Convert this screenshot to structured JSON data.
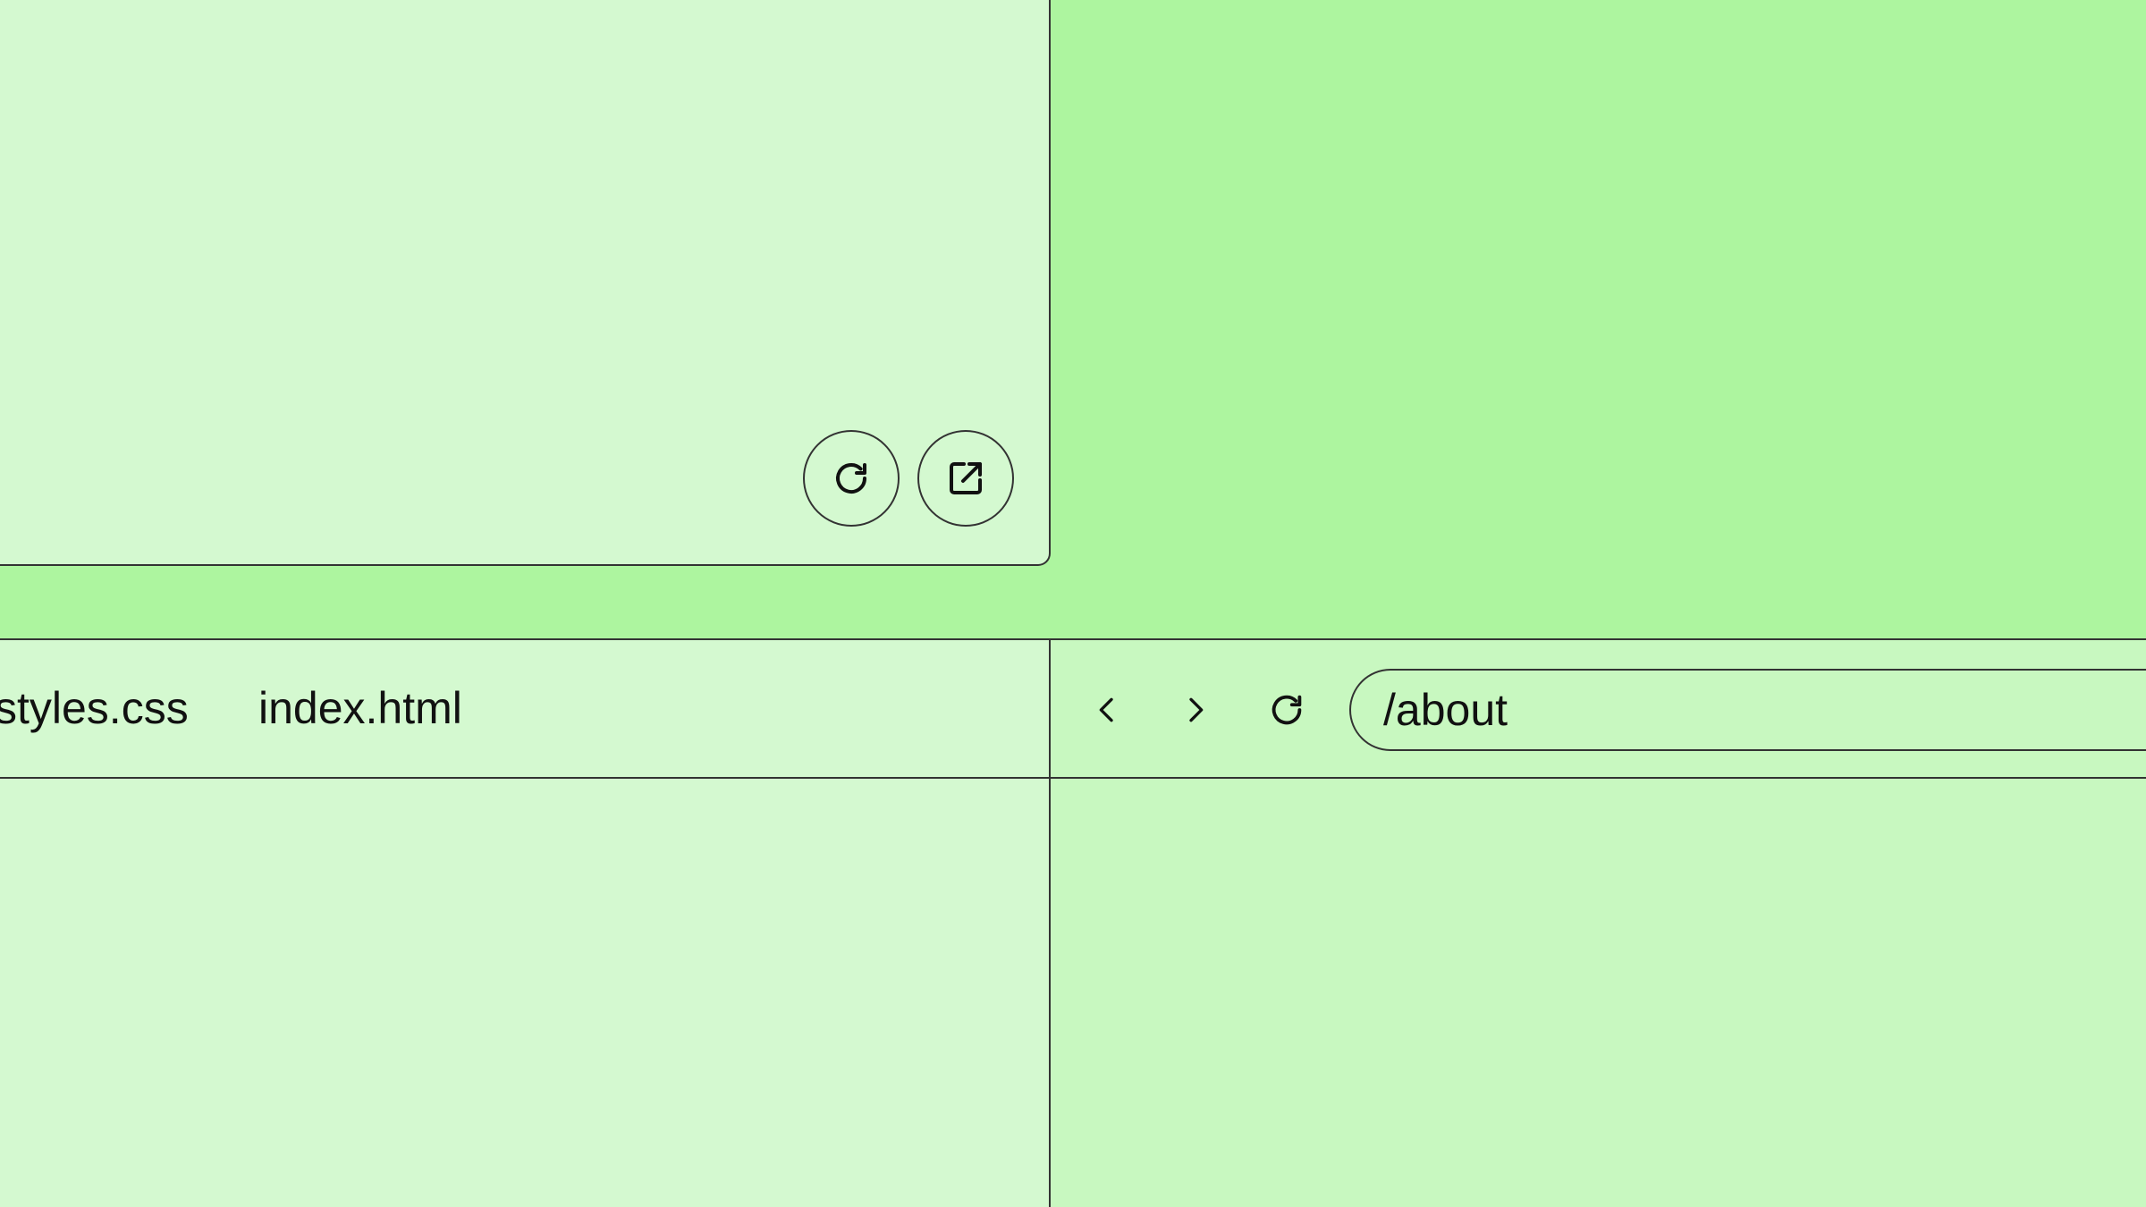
{
  "preview_card": {
    "refresh_icon": "refresh-icon",
    "open_external_icon": "external-link-icon"
  },
  "editor": {
    "tabs": [
      {
        "label": "styles.css"
      },
      {
        "label": "index.html"
      }
    ]
  },
  "browser": {
    "back_icon": "chevron-left-icon",
    "forward_icon": "chevron-right-icon",
    "reload_icon": "refresh-icon",
    "url": "/about"
  },
  "colors": {
    "background": "#adf59f",
    "panel": "#d4f9d0",
    "preview_panel": "#c8f8c0",
    "border": "#333333"
  }
}
